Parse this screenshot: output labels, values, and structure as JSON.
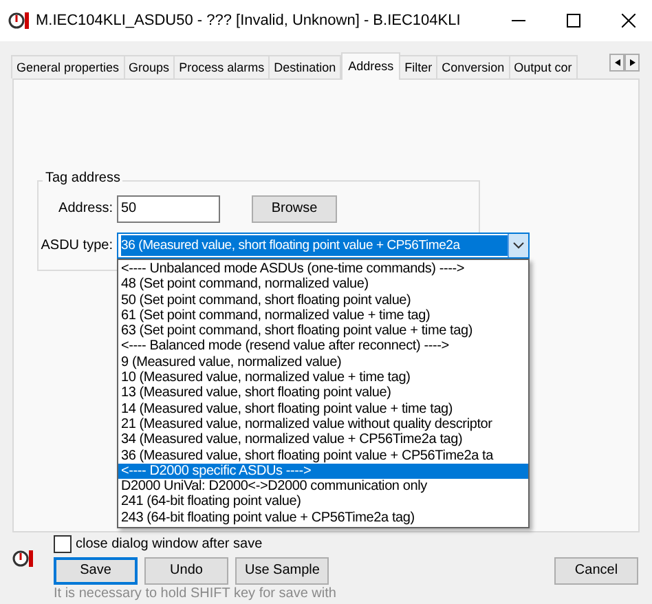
{
  "window": {
    "title": "M.IEC104KLI_ASDU50 - ??? [Invalid, Unknown] - B.IEC104KLI"
  },
  "tabs": [
    {
      "label": "General properties",
      "selected": false
    },
    {
      "label": "Groups",
      "selected": false
    },
    {
      "label": "Process alarms",
      "selected": false
    },
    {
      "label": "Destination",
      "selected": false
    },
    {
      "label": "Address",
      "selected": true
    },
    {
      "label": "Filter",
      "selected": false
    },
    {
      "label": "Conversion",
      "selected": false
    },
    {
      "label": "Output cor",
      "selected": false
    }
  ],
  "tag_address": {
    "title": "Tag address",
    "address_label": "Address:",
    "address_value": "50",
    "browse_button": "Browse",
    "asdu_label": "ASDU type:",
    "asdu_value": "36 (Measured value, short floating point value + CP56Time2a",
    "asdu_options": [
      {
        "label": "<---- Unbalanced mode ASDUs (one-time commands) ---->",
        "selected": false
      },
      {
        "label": "48 (Set point command, normalized value)",
        "selected": false
      },
      {
        "label": "50 (Set point command, short floating point value)",
        "selected": false
      },
      {
        "label": "61 (Set point command, normalized value + time tag)",
        "selected": false
      },
      {
        "label": "63 (Set point command, short floating point value + time tag)",
        "selected": false
      },
      {
        "label": "<---- Balanced mode (resend value after reconnect) ---->",
        "selected": false
      },
      {
        "label": "9 (Measured value, normalized value)",
        "selected": false
      },
      {
        "label": "10 (Measured value, normalized value + time tag)",
        "selected": false
      },
      {
        "label": "13 (Measured value, short floating point value)",
        "selected": false
      },
      {
        "label": "14 (Measured value, short floating point value + time tag)",
        "selected": false
      },
      {
        "label": "21 (Measured value, normalized value without quality descriptor",
        "selected": false
      },
      {
        "label": "34 (Measured value, normalized value + CP56Time2a tag)",
        "selected": false
      },
      {
        "label": "36 (Measured value, short floating point value + CP56Time2a ta",
        "selected": false
      },
      {
        "label": "<---- D2000 specific ASDUs ---->",
        "selected": true
      },
      {
        "label": "D2000 UniVal: D2000<->D2000 communication only",
        "selected": false
      },
      {
        "label": "241 (64-bit floating point value)",
        "selected": false
      },
      {
        "label": "243 (64-bit floating point value + CP56Time2a tag)",
        "selected": false
      }
    ]
  },
  "close_after_save": {
    "label": "close dialog window after save",
    "checked": false
  },
  "buttons": [
    {
      "label": "Save",
      "default": true
    },
    {
      "label": "Undo",
      "default": false
    },
    {
      "label": "Use Sample",
      "default": false
    }
  ],
  "cancel_button": "Cancel",
  "hint": "It is necessary to hold SHIFT key for save with"
}
